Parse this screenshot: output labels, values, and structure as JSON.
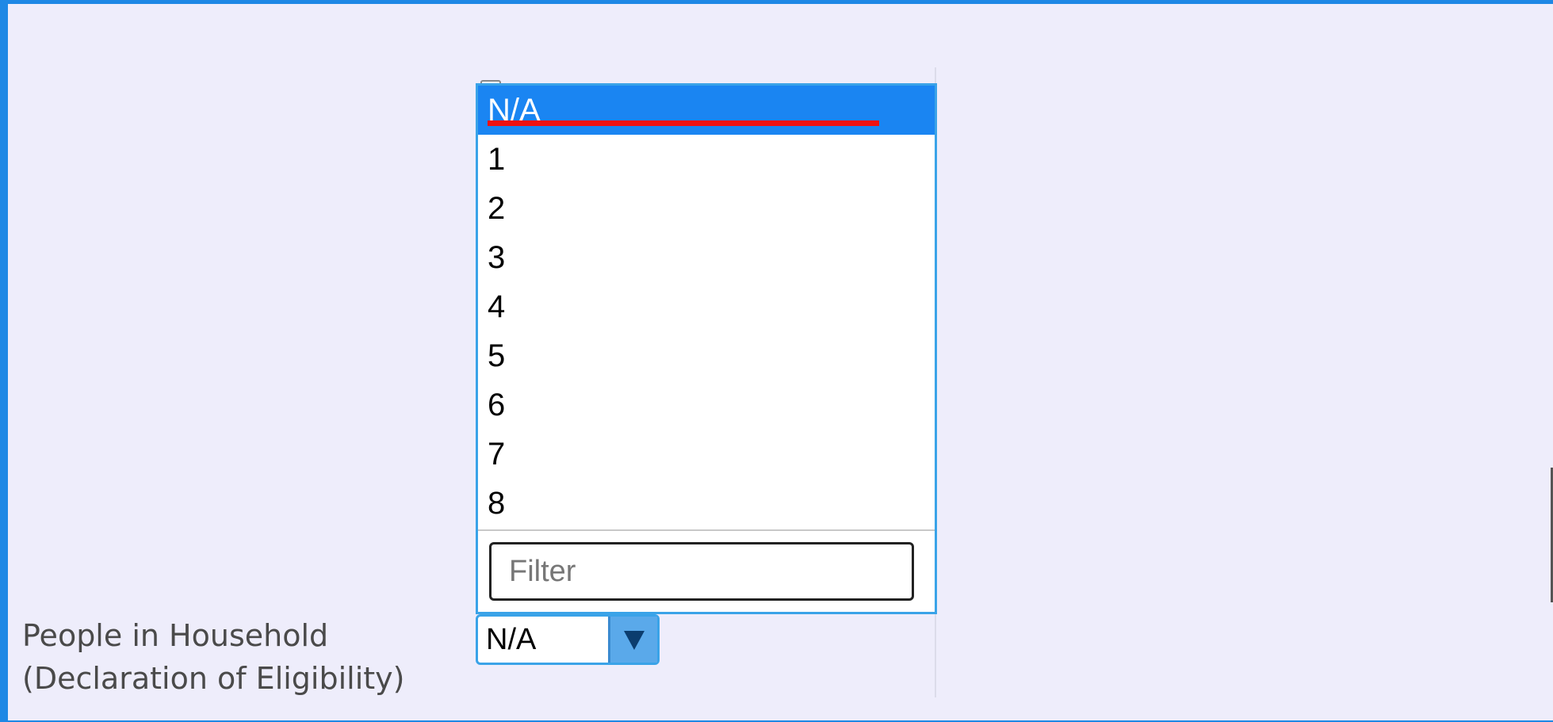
{
  "form": {
    "field_label": "People in Household (Declaration of Eligibility)",
    "selected_value": "N/A"
  },
  "dropdown": {
    "options": [
      "N/A",
      "1",
      "2",
      "3",
      "4",
      "5",
      "6",
      "7",
      "8"
    ],
    "highlighted_option": "N/A",
    "filter_placeholder": "Filter"
  },
  "colors": {
    "frame": "#1e88e5",
    "page_background": "#eeedfb",
    "highlight": "#1a85f2",
    "strike_mark": "#ef1111",
    "select_border": "#3aa3e8"
  },
  "icons": {
    "select_arrow": "triangle-down-icon"
  }
}
